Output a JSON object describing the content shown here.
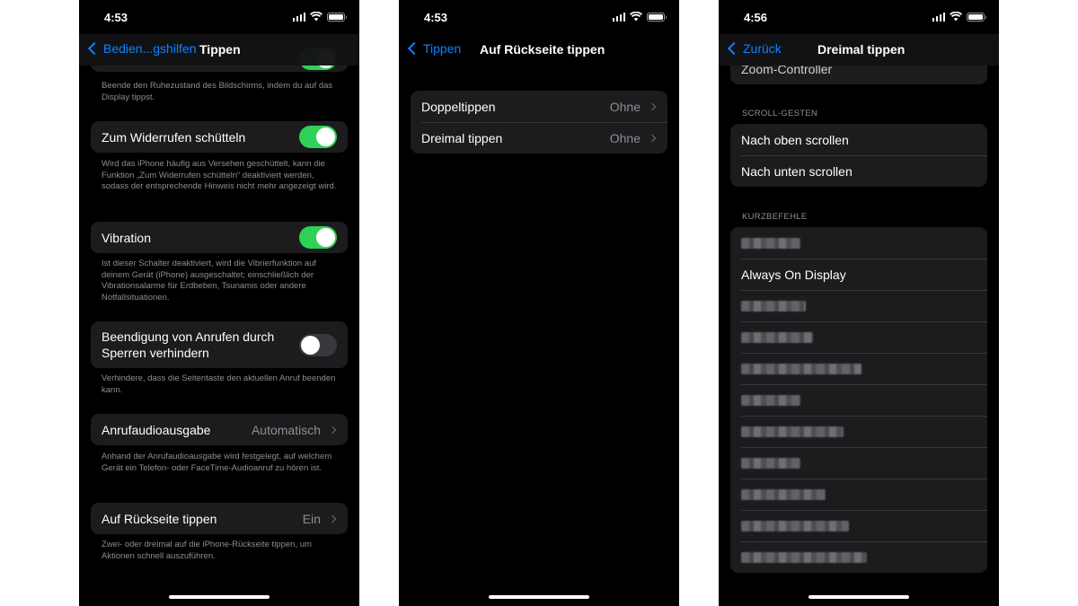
{
  "status_times": [
    "4:53",
    "4:53",
    "4:56"
  ],
  "screen1": {
    "back_label": "Bedien...gshilfen",
    "title": "Tippen",
    "top_footer": "Beende den Ruhezustand des Bildschirms, indem du auf das Display tippst.",
    "shake_undo": {
      "label": "Zum Widerrufen schütteln",
      "enabled": true,
      "footer": "Wird das iPhone häufig aus Versehen geschüttelt, kann die Funktion „Zum Widerrufen schütteln“ deaktiviert werden, sodass der entsprechende Hinweis nicht mehr angezeigt wird."
    },
    "vibration": {
      "label": "Vibration",
      "enabled": true,
      "footer": "Ist dieser Schalter deaktiviert, wird die Vibrierfunktion auf deinem Gerät (iPhone) ausgeschaltet; einschließlich der Vibrationsalarme für Erdbeben, Tsunamis oder andere Notfallsituationen."
    },
    "prevent_lock_end_call": {
      "label": "Beendigung von Anrufen durch Sperren verhindern",
      "enabled": false,
      "footer": "Verhindere, dass die Seitentaste den aktuellen Anruf beenden kann."
    },
    "call_audio_routing": {
      "label": "Anrufaudioausgabe",
      "value": "Automatisch",
      "footer": "Anhand der Anrufaudioausgabe wird festgelegt, auf welchem Gerät ein Telefon- oder FaceTime-Audioanruf zu hören ist."
    },
    "back_tap": {
      "label": "Auf Rückseite tippen",
      "value": "Ein",
      "footer": "Zwei- oder dreimal auf die iPhone-Rückseite tippen, um Aktionen schnell auszuführen."
    }
  },
  "screen2": {
    "back_label": "Tippen",
    "title": "Auf Rückseite tippen",
    "rows": [
      {
        "label": "Doppeltippen",
        "value": "Ohne"
      },
      {
        "label": "Dreimal tippen",
        "value": "Ohne"
      }
    ]
  },
  "screen3": {
    "back_label": "Zurück",
    "title": "Dreimal tippen",
    "partial_row": "Zoom-Controller",
    "scroll_header": "SCROLL-GESTEN",
    "scroll_rows": [
      "Nach oben scrollen",
      "Nach unten scrollen"
    ],
    "shortcuts_header": "KURZBEFEHLE",
    "shortcut_visible": "Always On Display",
    "blurred_shortcut_count": 10
  },
  "colors": {
    "accent": "#0a84ff",
    "toggle_on": "#30d158",
    "cell_background": "#1c1c1e",
    "secondary_text": "#8e8e93"
  },
  "icons": [
    "signal-icon",
    "wifi-icon",
    "battery-icon",
    "chevron-left-icon",
    "chevron-right-icon"
  ]
}
